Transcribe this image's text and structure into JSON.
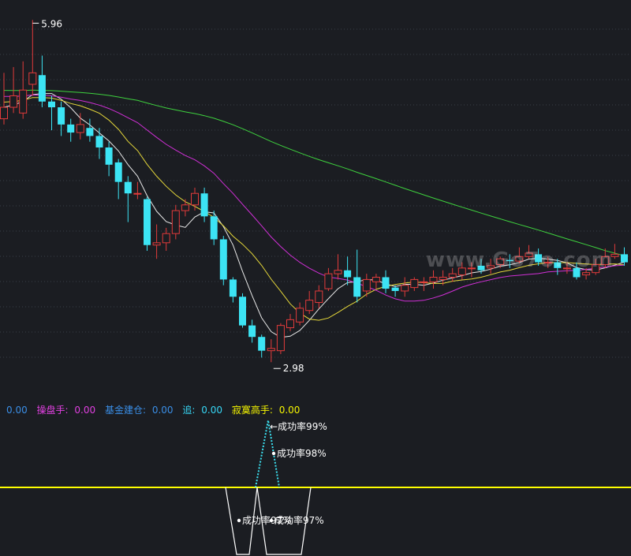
{
  "chart_data": {
    "type": "candlestick",
    "price_range": [
      2.7,
      6.1
    ],
    "high_label": "5.96",
    "low_label": "2.98",
    "candles": [
      [
        5.1,
        5.2,
        5.5,
        5.05
      ],
      [
        5.2,
        5.3,
        5.55,
        5.15
      ],
      [
        5.15,
        5.35,
        5.6,
        5.1
      ],
      [
        5.4,
        5.5,
        5.96,
        5.3
      ],
      [
        5.48,
        5.25,
        5.65,
        5.2
      ],
      [
        5.25,
        5.2,
        5.3,
        5.0
      ],
      [
        5.2,
        5.05,
        5.25,
        4.95
      ],
      [
        5.05,
        4.98,
        5.1,
        4.9
      ],
      [
        4.98,
        5.05,
        5.15,
        4.92
      ],
      [
        5.02,
        4.95,
        5.1,
        4.9
      ],
      [
        4.95,
        4.85,
        5.02,
        4.75
      ],
      [
        4.85,
        4.7,
        4.9,
        4.6
      ],
      [
        4.72,
        4.55,
        4.75,
        4.4
      ],
      [
        4.55,
        4.45,
        4.6,
        4.2
      ],
      [
        4.45,
        4.45,
        4.55,
        4.4
      ],
      [
        4.4,
        4.0,
        4.42,
        3.95
      ],
      [
        4.0,
        4.02,
        4.18,
        3.88
      ],
      [
        4.02,
        4.1,
        4.15,
        3.95
      ],
      [
        4.1,
        4.3,
        4.35,
        4.05
      ],
      [
        4.3,
        4.35,
        4.4,
        4.25
      ],
      [
        4.35,
        4.45,
        4.5,
        4.3
      ],
      [
        4.45,
        4.25,
        4.5,
        4.2
      ],
      [
        4.25,
        4.05,
        4.3,
        4.0
      ],
      [
        4.05,
        3.7,
        4.08,
        3.65
      ],
      [
        3.7,
        3.55,
        3.72,
        3.5
      ],
      [
        3.55,
        3.3,
        3.58,
        3.28
      ],
      [
        3.3,
        3.2,
        3.35,
        3.15
      ],
      [
        3.2,
        3.08,
        3.22,
        3.02
      ],
      [
        3.08,
        3.1,
        3.18,
        2.98
      ],
      [
        3.08,
        3.3,
        3.32,
        3.05
      ],
      [
        3.28,
        3.35,
        3.4,
        3.25
      ],
      [
        3.33,
        3.45,
        3.5,
        3.3
      ],
      [
        3.43,
        3.52,
        3.6,
        3.4
      ],
      [
        3.5,
        3.6,
        3.65,
        3.45
      ],
      [
        3.62,
        3.75,
        3.8,
        3.6
      ],
      [
        3.75,
        3.78,
        3.92,
        3.7
      ],
      [
        3.78,
        3.72,
        3.9,
        3.65
      ],
      [
        3.72,
        3.55,
        3.96,
        3.5
      ],
      [
        3.6,
        3.7,
        3.75,
        3.55
      ],
      [
        3.68,
        3.72,
        3.75,
        3.62
      ],
      [
        3.72,
        3.62,
        3.78,
        3.58
      ],
      [
        3.63,
        3.6,
        3.65,
        3.55
      ],
      [
        3.6,
        3.65,
        3.72,
        3.55
      ],
      [
        3.63,
        3.7,
        3.72,
        3.6
      ],
      [
        3.68,
        3.68,
        3.72,
        3.6
      ],
      [
        3.68,
        3.72,
        3.78,
        3.62
      ],
      [
        3.7,
        3.72,
        3.78,
        3.65
      ],
      [
        3.72,
        3.75,
        3.8,
        3.68
      ],
      [
        3.74,
        3.8,
        3.85,
        3.7
      ],
      [
        3.8,
        3.8,
        3.85,
        3.72
      ],
      [
        3.82,
        3.78,
        3.88,
        3.75
      ],
      [
        3.8,
        3.82,
        3.88,
        3.75
      ],
      [
        3.83,
        3.88,
        3.9,
        3.8
      ],
      [
        3.87,
        3.86,
        3.92,
        3.8
      ],
      [
        3.86,
        3.9,
        3.98,
        3.84
      ],
      [
        3.9,
        3.93,
        4.0,
        3.88
      ],
      [
        3.92,
        3.85,
        3.97,
        3.82
      ],
      [
        3.85,
        3.85,
        3.9,
        3.8
      ],
      [
        3.85,
        3.8,
        3.88,
        3.74
      ],
      [
        3.8,
        3.8,
        3.85,
        3.75
      ],
      [
        3.8,
        3.72,
        3.85,
        3.7
      ],
      [
        3.74,
        3.76,
        3.8,
        3.7
      ],
      [
        3.76,
        3.83,
        3.88,
        3.74
      ],
      [
        3.83,
        3.9,
        3.97,
        3.8
      ],
      [
        3.9,
        3.92,
        4.01,
        3.88
      ],
      [
        3.92,
        3.85,
        3.98,
        3.82
      ]
    ],
    "indicator_legend": [
      {
        "name": "",
        "value": "0.00",
        "color": "#3a8ee6"
      },
      {
        "name": "操盘手:",
        "value": "0.00",
        "color": "#e040e0"
      },
      {
        "name": "基金建仓:",
        "value": "0.00",
        "color": "#3a8ee6"
      },
      {
        "name": "追:",
        "value": "0.00",
        "color": "#36d6f5"
      },
      {
        "name": "寂寞高手:",
        "value": "0.00",
        "color": "#f5f500"
      }
    ],
    "signals": {
      "upper_1": "←成功率99%",
      "upper_2": "成功率98%",
      "lower": "成功率97%"
    },
    "colors": {
      "background": "#1b1d22",
      "up": "#e23b3b",
      "down": "#3ce4f4",
      "ma_white": "#e8e8e8",
      "ma_yellow": "#e6d83a",
      "ma_magenta": "#d02fd6",
      "ma_green": "#3ed13e",
      "signal_line": "#ffff00"
    }
  },
  "watermark": "www.Go7o.com"
}
